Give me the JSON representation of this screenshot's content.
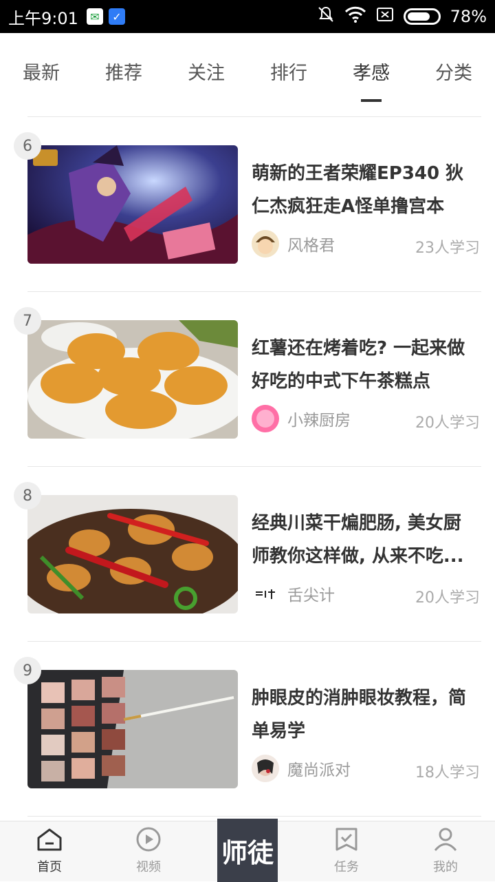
{
  "status_bar": {
    "time": "上午9:01",
    "battery": "78%",
    "battery_level": 0.78
  },
  "tabs": [
    {
      "label": "最新"
    },
    {
      "label": "推荐"
    },
    {
      "label": "关注"
    },
    {
      "label": "排行"
    },
    {
      "label": "孝感"
    },
    {
      "label": "分类"
    }
  ],
  "active_tab": "孝感",
  "items": [
    {
      "rank": "6",
      "title": "萌新的王者荣耀EP340 狄仁杰疯狂走A怪单撸宫本",
      "author": "风格君",
      "learners": "23人学习"
    },
    {
      "rank": "7",
      "title": "红薯还在烤着吃? 一起来做好吃的中式下午茶糕点",
      "author": "小辣厨房",
      "learners": "20人学习"
    },
    {
      "rank": "8",
      "title": "经典川菜干煸肥肠, 美女厨师教你这样做, 从来不吃...",
      "author": "舌尖计",
      "learners": "20人学习"
    },
    {
      "rank": "9",
      "title": "肿眼皮的消肿眼妆教程，简单易学",
      "author": "魔尚派对",
      "learners": "18人学习"
    }
  ],
  "nav": {
    "home": "首页",
    "video": "视频",
    "center": "师徒",
    "task": "任务",
    "mine": "我的"
  }
}
